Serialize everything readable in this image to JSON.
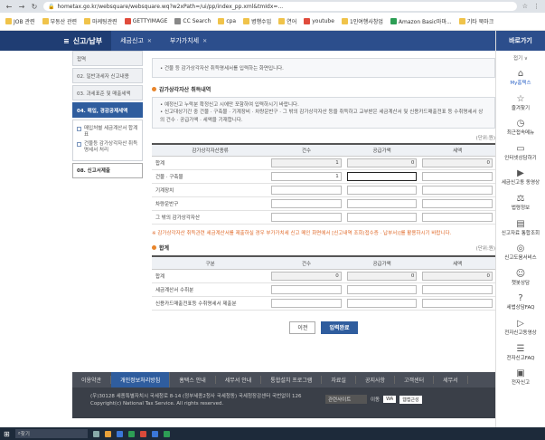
{
  "browser": {
    "url": "hometax.go.kr/websquare/websquare.wq?w2xPath=/ui/pp/index_pp.xml&tmIdx=..."
  },
  "bookmarks": [
    {
      "label": "JOB 관련",
      "color": "#f0c34a"
    },
    {
      "label": "부동산 관련",
      "color": "#f0c34a"
    },
    {
      "label": "마케팅관련",
      "color": "#f0c34a"
    },
    {
      "label": "GETTYIMAGE",
      "color": "#e04b3c"
    },
    {
      "label": "CC Search",
      "color": "#888888"
    },
    {
      "label": "cpa",
      "color": "#f0c34a"
    },
    {
      "label": "병행수입",
      "color": "#f0c34a"
    },
    {
      "label": "연어",
      "color": "#f0c34a"
    },
    {
      "label": "youtube",
      "color": "#e04b3c"
    },
    {
      "label": "1인여행사창업",
      "color": "#f0c34a"
    },
    {
      "label": "Amazon Basic마마...",
      "color": "#2d9e55"
    },
    {
      "label": "기타 북마크",
      "color": "#f0c34a"
    }
  ],
  "topnav": {
    "active": "신고/납부",
    "tabs": [
      "세금신고",
      "부가가치세"
    ]
  },
  "steps": [
    {
      "label": "접역",
      "state": "normal"
    },
    {
      "label": "02. 일반과세자 신고내용",
      "state": "normal"
    },
    {
      "label": "03. 과세표준 및 매출세액",
      "state": "normal"
    },
    {
      "label": "04. 매입, 경감공제세액",
      "state": "active"
    }
  ],
  "substeps": [
    "매입처별 세금계산서 합계표",
    "건물등 감가상각자산 취득명세서 처리"
  ],
  "current_step": "08. 신고서제출",
  "desc": "건물 등 감가상각자산 취득명세서를 입력하는 화면입니다.",
  "section1": {
    "title": "감가상각자산 취득내역",
    "notes": [
      "예정신고 누락분 확정신고 시에만 포함하여 입력하시기 바랍니다.",
      "신고대상기간 중 건물 · 구축물 · 기계장비 · 차량운반구 · 그 밖의 감가상각자산 등을 취득하고 교부받은 세금계산서 및 신용카드매출전표 등 수취명세서 상의 건수 · 공급가액 · 세액을 기재합니다."
    ],
    "unit": "(단위:원)",
    "headers": [
      "감가상각자산종류",
      "건수",
      "공급가액",
      "세액"
    ],
    "rows": [
      {
        "label": "합계",
        "count": "1",
        "amount": "0",
        "tax": "0"
      },
      {
        "label": "건물 · 구축물",
        "count": "1",
        "amount": "",
        "tax": ""
      },
      {
        "label": "기계장치",
        "count": "",
        "amount": "",
        "tax": ""
      },
      {
        "label": "차량운반구",
        "count": "",
        "amount": "",
        "tax": ""
      },
      {
        "label": "그 밖의 감가상각자산",
        "count": "",
        "amount": "",
        "tax": ""
      }
    ],
    "warning": "※ 감가상각자산 취득관련 세금계산서를 제출하실 경우 부가가치세 신고 메인 화면에서 [신고내역 조회(접수증 · 납부서)]를 활용하시기 바랍니다."
  },
  "section2": {
    "title": "합계",
    "unit": "(단위:원)",
    "headers": [
      "구분",
      "건수",
      "공급가액",
      "세액"
    ],
    "rows": [
      {
        "label": "합계",
        "count": "0",
        "amount": "0",
        "tax": "0"
      },
      {
        "label": "세금계산서 수취분",
        "count": "",
        "amount": "",
        "tax": ""
      },
      {
        "label": "신용카드매출전표등 수취명세서 제출분",
        "count": "",
        "amount": "",
        "tax": ""
      }
    ]
  },
  "buttons": {
    "prev": "이전",
    "submit": "입력완료"
  },
  "footer_nav": [
    "이용약관",
    "개인정보처리방침",
    "홈택스 안내",
    "세무서 안내",
    "통합설치 프로그램",
    "자료실",
    "공지사항",
    "고객센터",
    "세무서"
  ],
  "footer": {
    "address": "(우)30128 세종특별자치시 국세청로 8-14 (정부세종2청사 국세청동) 국세청장감센터 국번없이 126",
    "copyright": "Copyright(c) National Tax Service. All rights reserved.",
    "site_select": "관련사이트",
    "move": "이동",
    "badges": [
      "WA",
      "웹접근성"
    ]
  },
  "sidebar": {
    "title": "바로가기",
    "fold": "접기 ∨",
    "items": [
      "My홈택스",
      "즐겨찾기",
      "최근접속메뉴",
      "인터넷상담하기",
      "세금신고동 동영상",
      "법령정보",
      "신고자료 통합조회",
      "신고도움서비스",
      "챗봇상담",
      "세법상담FAQ",
      "전자신고동영상",
      "전자신고FAQ",
      "전자신고"
    ]
  },
  "taskbar": {
    "search": "찾기"
  }
}
